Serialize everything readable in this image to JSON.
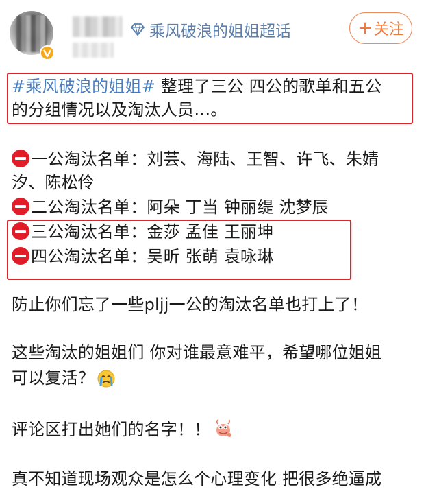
{
  "header": {
    "supertopic": "乘风破浪的姐姐超话",
    "follow_label": "关注",
    "follow_plus": "+"
  },
  "post": {
    "hashtag": "#乘风破浪的姐姐#",
    "intro_1": " 整理了三公 四公的歌单和五公",
    "intro_2": "的分组情况以及淘汰人员…。",
    "elim1_a": "一公淘汰名单：刘芸、海陆、王智、许飞、朱婧",
    "elim1_b": "汐、陈松伶",
    "elim2": "二公淘汰名单：阿朵 丁当 钟丽缇 沈梦辰",
    "elim3": "三公淘汰名单：金莎 孟佳 王丽坤",
    "elim4": "四公淘汰名单：吴昕 张萌 袁咏琳",
    "p1": "防止你们忘了一些pljj一公的淘汰名单也打上了！",
    "p2a": "这些淘汰的姐姐们 你对谁最意难平，希望哪位姐姐",
    "p2b": "可以复活？",
    "p3": "评论区打出她们的名字！！",
    "p4": "真不知道现场观众是怎么个心理变化 把很多绝逼成"
  },
  "icons": {
    "supertopic_icon": "diamond-icon",
    "verified_icon": "verified-v-icon",
    "stop_icon": "no-entry-icon",
    "crying_icon": "crying-face-emoji",
    "doge_icon": "shrimp-emoji"
  },
  "colors": {
    "hashtag": "#4a7dbd",
    "supertopic": "#5a7fb0",
    "follow": "#ee7a40",
    "highlight": "#d9262a",
    "stop": "#e11d2a"
  }
}
